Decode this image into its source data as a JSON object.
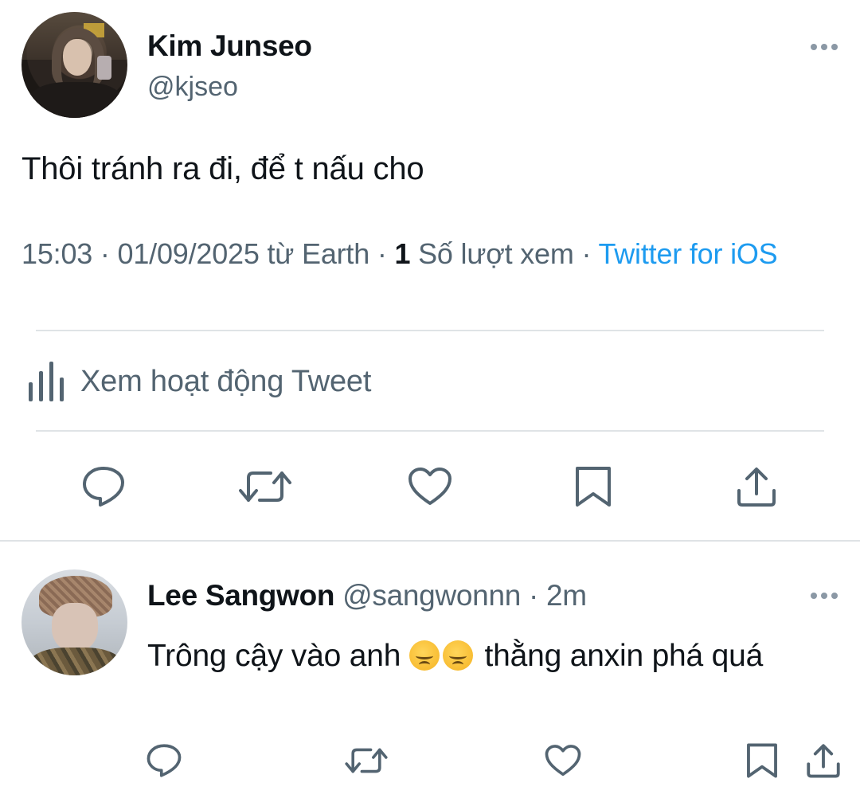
{
  "main_tweet": {
    "author_name": "Kim Junseo",
    "author_handle": "@kjseo",
    "text": "Thôi tránh ra đi, để t nấu cho",
    "meta": {
      "time": "15:03",
      "date": "01/09/2025",
      "location": "từ Earth",
      "view_count": "1",
      "view_label": "Số lượt xem",
      "source": "Twitter for iOS"
    },
    "activity_label": "Xem hoạt động Tweet",
    "actions": [
      "reply-icon",
      "retweet-icon",
      "like-icon",
      "bookmark-icon",
      "share-icon"
    ]
  },
  "reply": {
    "author_name": "Lee Sangwon",
    "author_handle": "@sangwonnn",
    "time": "2m",
    "text_before_emoji": "Trông cậy vào anh",
    "emoji": "😞😞",
    "text_after_emoji": "thằng anxin phá quá",
    "actions": [
      "reply-icon",
      "retweet-icon",
      "like-icon",
      "bookmark-icon",
      "share-icon"
    ]
  },
  "colors": {
    "text_primary": "#0f1419",
    "text_secondary": "#536471",
    "link": "#1d9bf0",
    "divider": "#dfe3e6"
  }
}
